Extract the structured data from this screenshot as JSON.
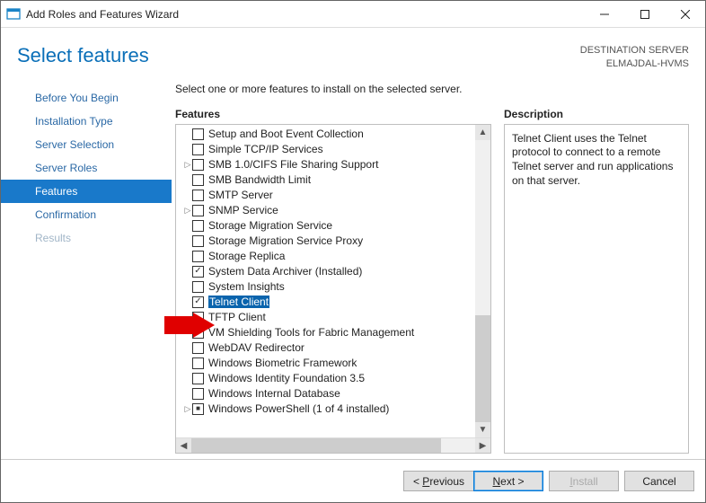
{
  "window": {
    "title": "Add Roles and Features Wizard"
  },
  "header": {
    "page_title": "Select features",
    "dest_label": "DESTINATION SERVER",
    "dest_value": "ELMAJDAL-HVMS"
  },
  "steps": {
    "before": "Before You Begin",
    "install_type": "Installation Type",
    "server_sel": "Server Selection",
    "server_roles": "Server Roles",
    "features": "Features",
    "confirmation": "Confirmation",
    "results": "Results"
  },
  "content": {
    "instruction": "Select one or more features to install on the selected server.",
    "features_header": "Features",
    "description_header": "Description",
    "description_text": "Telnet Client uses the Telnet protocol to connect to a remote Telnet server and run applications on that server."
  },
  "features": [
    {
      "label": "Setup and Boot Event Collection",
      "checked": false,
      "expand": false
    },
    {
      "label": "Simple TCP/IP Services",
      "checked": false,
      "expand": false
    },
    {
      "label": "SMB 1.0/CIFS File Sharing Support",
      "checked": false,
      "expand": true
    },
    {
      "label": "SMB Bandwidth Limit",
      "checked": false,
      "expand": false
    },
    {
      "label": "SMTP Server",
      "checked": false,
      "expand": false
    },
    {
      "label": "SNMP Service",
      "checked": false,
      "expand": true
    },
    {
      "label": "Storage Migration Service",
      "checked": false,
      "expand": false
    },
    {
      "label": "Storage Migration Service Proxy",
      "checked": false,
      "expand": false
    },
    {
      "label": "Storage Replica",
      "checked": false,
      "expand": false
    },
    {
      "label": "System Data Archiver (Installed)",
      "checked": true,
      "expand": false
    },
    {
      "label": "System Insights",
      "checked": false,
      "expand": false
    },
    {
      "label": "Telnet Client",
      "checked": true,
      "expand": false,
      "selected": true
    },
    {
      "label": "TFTP Client",
      "checked": false,
      "expand": false
    },
    {
      "label": "VM Shielding Tools for Fabric Management",
      "checked": false,
      "expand": false
    },
    {
      "label": "WebDAV Redirector",
      "checked": false,
      "expand": false
    },
    {
      "label": "Windows Biometric Framework",
      "checked": false,
      "expand": false
    },
    {
      "label": "Windows Identity Foundation 3.5",
      "checked": false,
      "expand": false
    },
    {
      "label": "Windows Internal Database",
      "checked": false,
      "expand": false
    },
    {
      "label": "Windows PowerShell (1 of 4 installed)",
      "checked": false,
      "partial": true,
      "expand": true
    }
  ],
  "buttons": {
    "previous": "< Previous",
    "next": "Next >",
    "install": "Install",
    "cancel": "Cancel"
  }
}
